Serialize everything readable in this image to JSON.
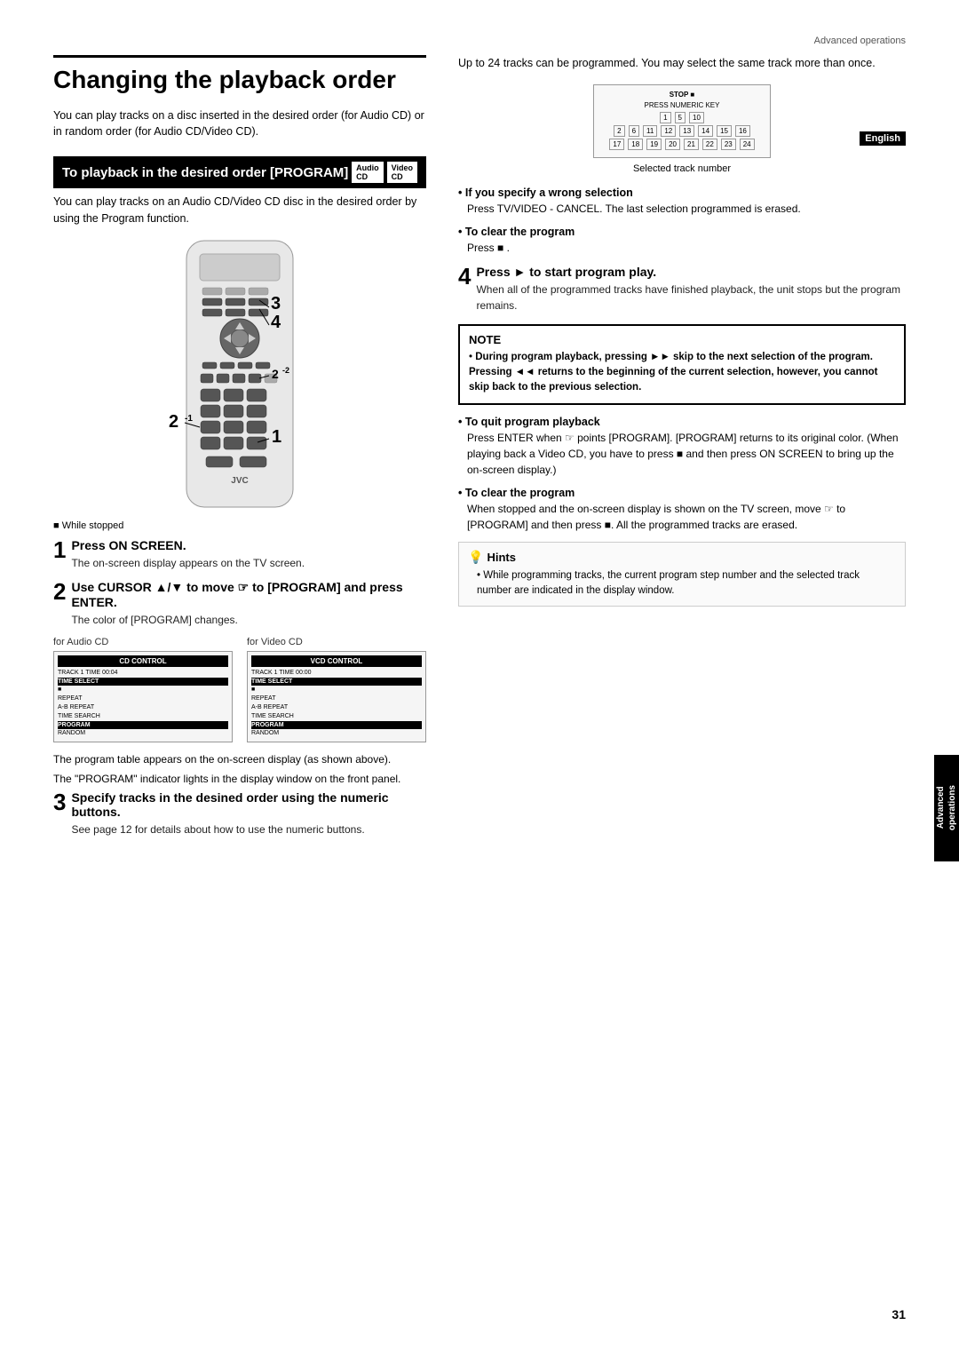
{
  "page": {
    "header": "Advanced operations",
    "page_number": "31",
    "english_badge": "English"
  },
  "advanced_sidebar": {
    "line1": "Advanced",
    "line2": "operations"
  },
  "main_title": "Changing the playback order",
  "intro": "You can play tracks on a disc inserted in the desired order (for Audio CD) or in random order (for Audio CD/Video CD).",
  "section_heading": "To playback in the desired order [PROGRAM]",
  "badges": {
    "audio": "Audio CD",
    "video": "Video CD"
  },
  "section_desc": "You can play tracks on an Audio CD/Video CD disc in the desired order by using the Program function.",
  "stopped_label": "While stopped",
  "steps_left": [
    {
      "number": "1",
      "title": "Press ON SCREEN.",
      "desc": "The on-screen display appears on the TV screen."
    },
    {
      "number": "2",
      "title": "Use CURSOR ▲/▼ to move ☞ to [PROGRAM] and press ENTER.",
      "desc": "The color of [PROGRAM] changes."
    }
  ],
  "cd_labels": {
    "audio": "for Audio CD",
    "video": "for Video CD"
  },
  "cd_audio_screen": {
    "title": "CD CONTROL",
    "rows": [
      "TRACK  1  TIME  00:04",
      "TIME SELECT",
      "■",
      "REPEAT",
      "A-B REPEAT",
      "TIME SEARCH",
      "PROGRAM",
      "RANDOM"
    ]
  },
  "cd_video_screen": {
    "title": "VCD CONTROL",
    "rows": [
      "TRACK  1  TIME  00:00",
      "TIME SELECT",
      "■",
      "REPEAT",
      "A-B REPEAT",
      "TIME SEARCH",
      "PROGRAM",
      "RANDOM"
    ]
  },
  "program_table_text1": "The program table appears on the on-screen display (as shown above).",
  "program_table_text2": "The \"PROGRAM\" indicator lights in the display window on the front panel.",
  "step3": {
    "number": "3",
    "title": "Specify tracks in the desined order using the numeric buttons.",
    "desc": "See page 12 for details about how to use the numeric buttons."
  },
  "right_col": {
    "intro": "Up to 24 tracks can be programmed. You may select the same track more than once.",
    "stop_label": "STOP ■",
    "press_numeric_label": "PRESS NUMERIC KEY",
    "track_numbers": [
      [
        "1",
        "5",
        "10"
      ],
      [
        "2",
        "6",
        "11",
        "12",
        "13",
        "14",
        "15",
        "16"
      ],
      [
        "17",
        "18",
        "19",
        "20",
        "21",
        "22",
        "23",
        "24"
      ]
    ],
    "selected_track_text": "Selected track number",
    "bullet1_title": "If you specify a wrong selection",
    "bullet1_text": "Press TV/VIDEO - CANCEL. The last selection programmed is erased.",
    "bullet2_title": "To clear the program",
    "bullet2_text": "Press ■ .",
    "step4_number": "4",
    "step4_title": "Press ► to start program play.",
    "step4_desc": "When all of the programmed tracks have finished playback, the unit stops but the program remains.",
    "note_title": "NOTE",
    "note_bullets": [
      "During program playback, pressing ►► skip to the next selection of the program. Pressing ◄◄ returns to the beginning of the current selection, however, you cannot skip back to the previous selection."
    ],
    "bullet3_title": "To quit program playback",
    "bullet3_text": "Press ENTER when ☞ points [PROGRAM]. [PROGRAM] returns to its original color. (When playing back a Video CD, you have to press ■ and then press ON SCREEN to bring up the on-screen display.)",
    "bullet4_title": "To clear the program",
    "bullet4_text": "When stopped and the on-screen display is shown on the TV screen, move ☞ to [PROGRAM] and then press ■. All the programmed tracks are erased.",
    "hints_title": "Hints",
    "hints_bullet": "While programming tracks, the current program step number and the selected track number are indicated in the display window."
  }
}
